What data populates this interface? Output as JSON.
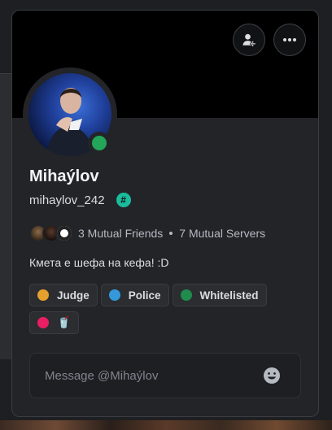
{
  "profile": {
    "display_name": "Mihaýlov",
    "username": "mihaylov_242",
    "status": "online",
    "badge_symbol": "#",
    "mutual_friends": "3 Mutual Friends",
    "mutual_servers": "7 Mutual Servers",
    "bio": "Кмета е шефа на кефа! :D"
  },
  "buttons": {
    "add_friend_icon": "add-friend-icon",
    "more_icon": "more-options-icon"
  },
  "roles": [
    {
      "label": "Judge",
      "color": "#e6a02e"
    },
    {
      "label": "Police",
      "color": "#3498db"
    },
    {
      "label": "Whitelisted",
      "color": "#1f8b4c"
    },
    {
      "label": "🥤",
      "color": "#e91e63"
    }
  ],
  "message": {
    "placeholder": "Message @Mihaýlov"
  },
  "colors": {
    "banner": "#000000",
    "card": "#232428",
    "status_online": "#23a55a",
    "badge": "#1abc9c"
  }
}
